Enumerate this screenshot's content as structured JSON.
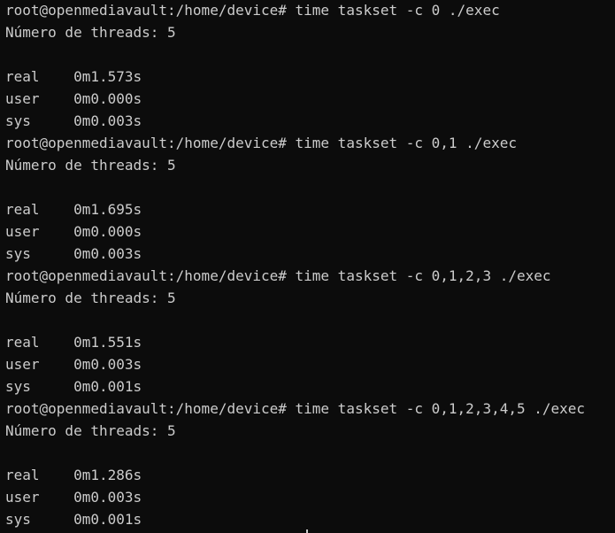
{
  "terminal": {
    "lines": [
      "root@openmediavault:/home/device# time taskset -c 0 ./exec",
      "Número de threads: 5",
      "",
      "real    0m1.573s",
      "user    0m0.000s",
      "sys     0m0.003s",
      "root@openmediavault:/home/device# time taskset -c 0,1 ./exec",
      "Número de threads: 5",
      "",
      "real    0m1.695s",
      "user    0m0.000s",
      "sys     0m0.003s",
      "root@openmediavault:/home/device# time taskset -c 0,1,2,3 ./exec",
      "Número de threads: 5",
      "",
      "real    0m1.551s",
      "user    0m0.003s",
      "sys     0m0.001s",
      "root@openmediavault:/home/device# time taskset -c 0,1,2,3,4,5 ./exec",
      "Número de threads: 5",
      "",
      "real    0m1.286s",
      "user    0m0.003s",
      "sys     0m0.001s"
    ]
  }
}
